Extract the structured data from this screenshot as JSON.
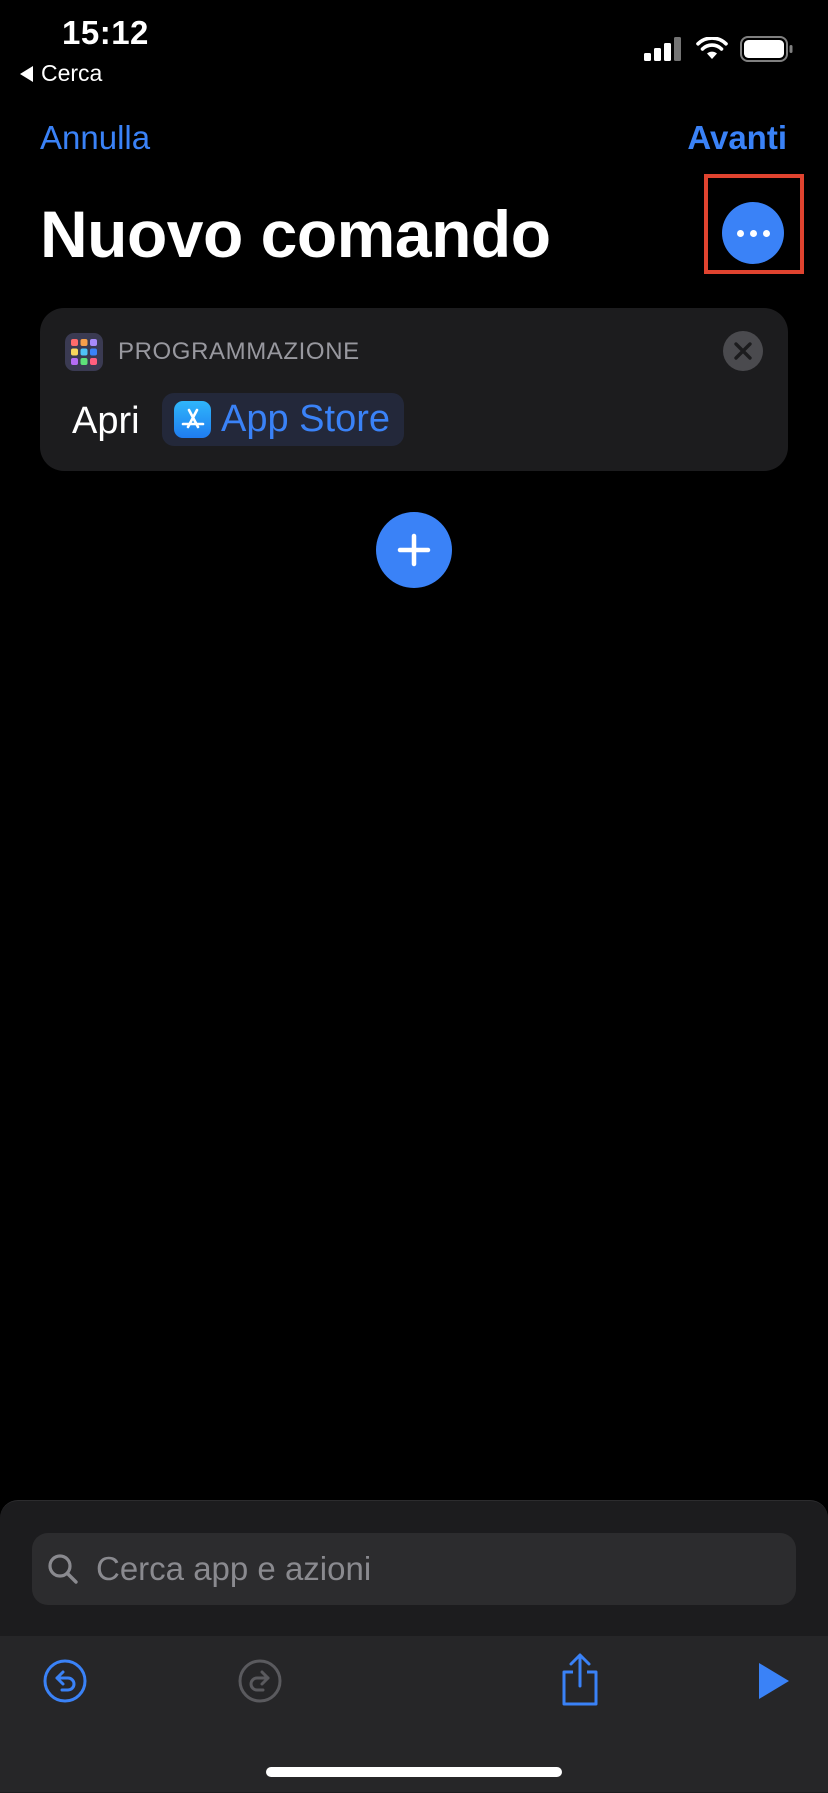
{
  "status_bar": {
    "time": "15:12",
    "back_label": "Cerca"
  },
  "nav": {
    "cancel_label": "Annulla",
    "next_label": "Avanti"
  },
  "page": {
    "title": "Nuovo comando"
  },
  "action_card": {
    "category": "PROGRAMMAZIONE",
    "verb": "Apri",
    "app_name": "App Store"
  },
  "search": {
    "placeholder": "Cerca app e azioni",
    "value": ""
  },
  "icons": {
    "more": "ellipsis-icon",
    "close": "close-icon",
    "add": "plus-icon",
    "undo": "undo-icon",
    "redo": "redo-icon",
    "share": "share-icon",
    "play": "play-icon"
  },
  "colors": {
    "accent": "#3a82f7",
    "highlight": "#e0432f",
    "background": "#000000",
    "panel": "#1c1c1e"
  }
}
